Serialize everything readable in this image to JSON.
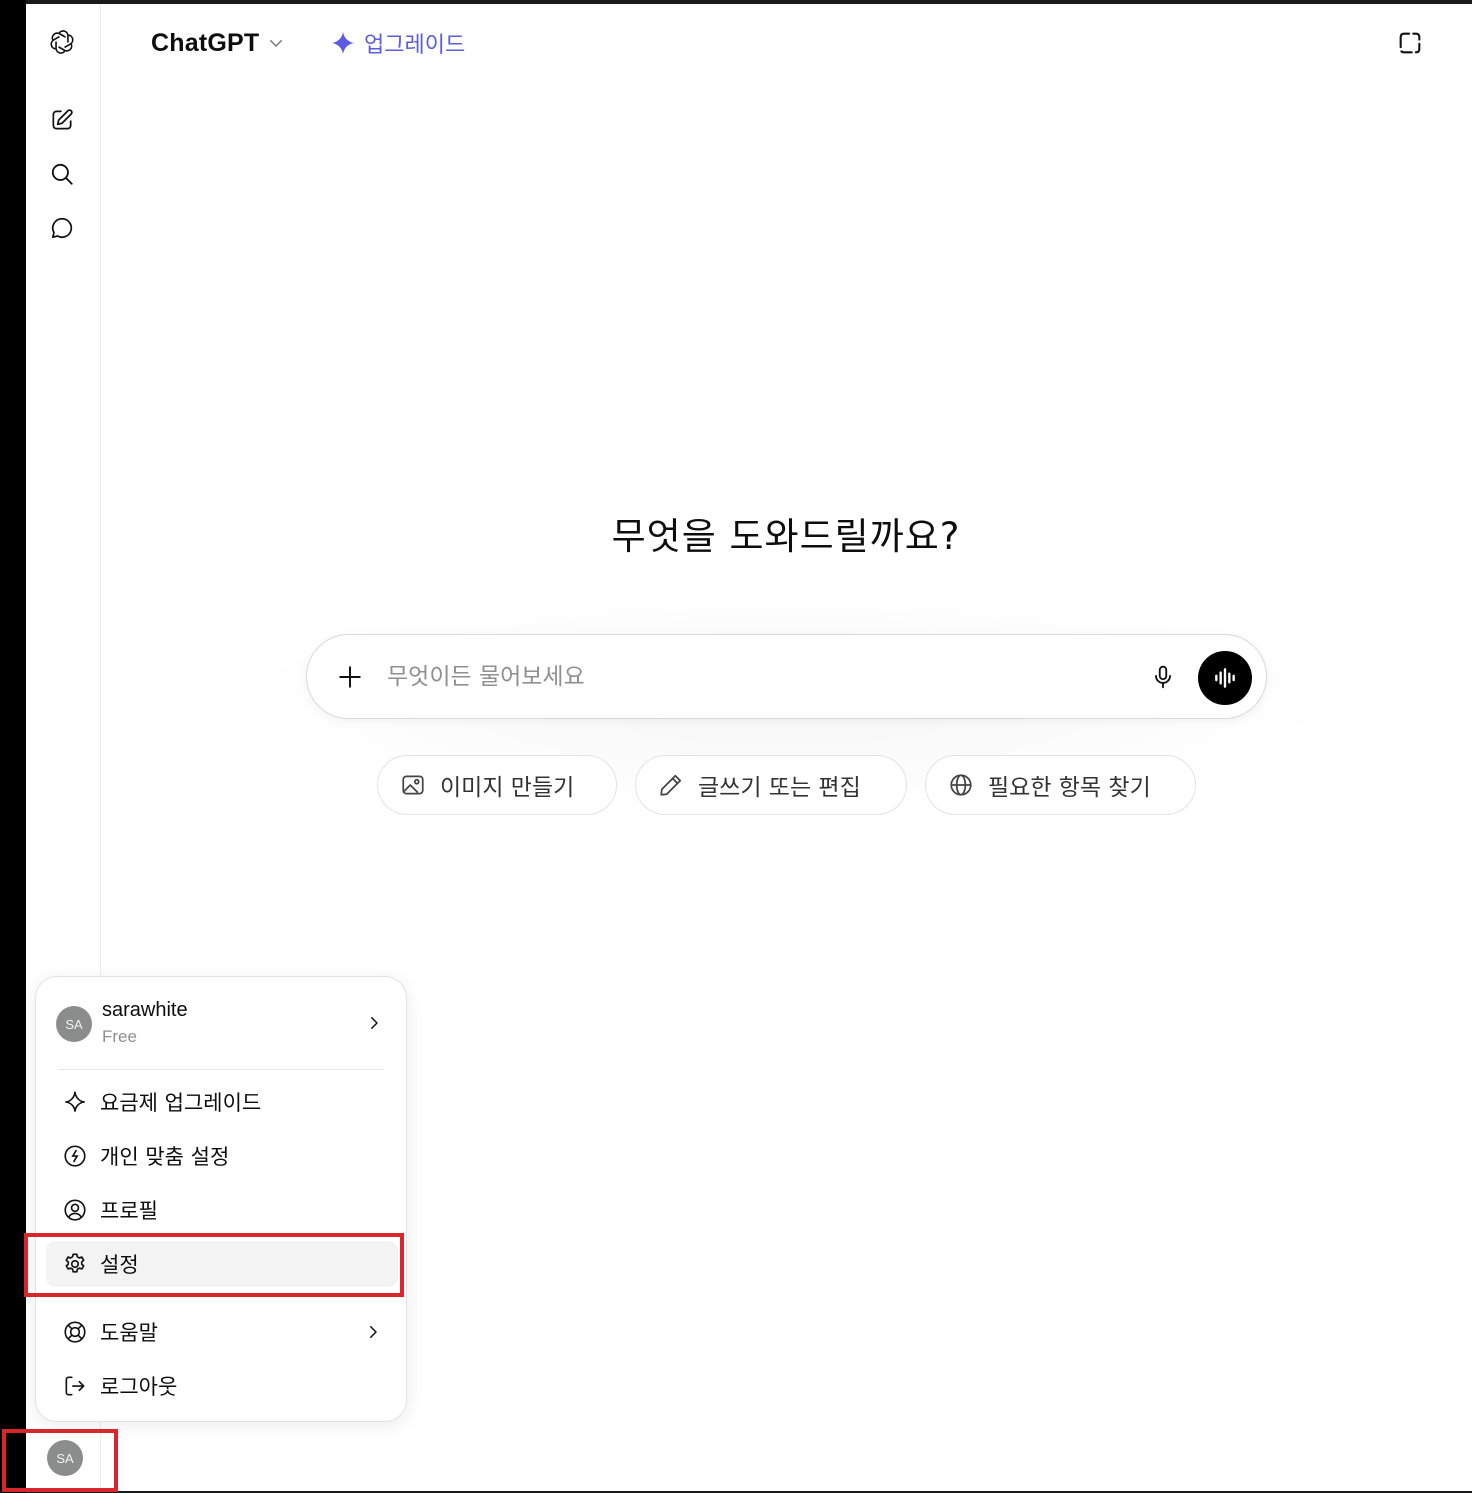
{
  "header": {
    "model_name": "ChatGPT",
    "upgrade_label": "업그레이드"
  },
  "main": {
    "headline": "무엇을 도와드릴까요?",
    "composer_placeholder": "무엇이든 물어보세요",
    "chips": [
      {
        "label": "이미지 만들기",
        "icon": "image-icon"
      },
      {
        "label": "글쓰기 또는 편집",
        "icon": "pencil-icon"
      },
      {
        "label": "필요한 항목 찾기",
        "icon": "globe-icon"
      }
    ]
  },
  "account_menu": {
    "avatar_initials": "SA",
    "username": "sarawhite",
    "plan": "Free",
    "items": [
      {
        "label": "요금제 업그레이드",
        "icon": "sparkle-icon"
      },
      {
        "label": "개인 맞춤 설정",
        "icon": "personalize-icon"
      },
      {
        "label": "프로필",
        "icon": "profile-icon"
      },
      {
        "label": "설정",
        "icon": "gear-icon",
        "highlighted": true
      },
      {
        "label": "도움말",
        "icon": "lifebuoy-icon",
        "has_submenu": true
      },
      {
        "label": "로그아웃",
        "icon": "logout-icon"
      }
    ]
  },
  "footer": {
    "avatar_initials": "SA"
  },
  "colors": {
    "accent": "#5b5ce0",
    "annotation": "#d9262a",
    "avatar": "#8a8d8c"
  }
}
